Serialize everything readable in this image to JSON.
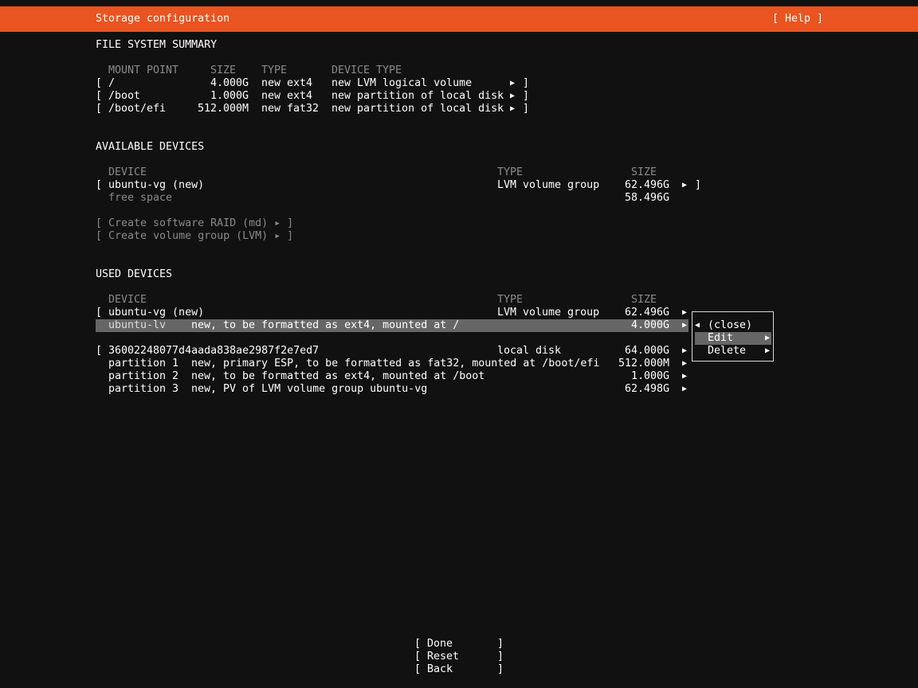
{
  "header": {
    "title": "Storage configuration",
    "help": "[ Help ]"
  },
  "fs_summary": {
    "heading": "FILE SYSTEM SUMMARY",
    "columns": {
      "mount": "MOUNT POINT",
      "size": "SIZE",
      "type": "TYPE",
      "device_type": "DEVICE TYPE"
    },
    "rows": [
      {
        "mount": "/",
        "size": "4.000G",
        "type": "new ext4",
        "device_type": "new LVM logical volume"
      },
      {
        "mount": "/boot",
        "size": "1.000G",
        "type": "new ext4",
        "device_type": "new partition of local disk"
      },
      {
        "mount": "/boot/efi",
        "size": "512.000M",
        "type": "new fat32",
        "device_type": "new partition of local disk"
      }
    ]
  },
  "available": {
    "heading": "AVAILABLE DEVICES",
    "columns": {
      "device": "DEVICE",
      "type": "TYPE",
      "size": "SIZE"
    },
    "vg_name": "ubuntu-vg (new)",
    "vg_type": "LVM volume group",
    "vg_size": "62.496G",
    "free_label": "free space",
    "free_size": "58.496G",
    "raid_action": "[ Create software RAID (md) ▸ ]",
    "lvm_action": "[ Create volume group (LVM) ▸ ]"
  },
  "used": {
    "heading": "USED DEVICES",
    "columns": {
      "device": "DEVICE",
      "type": "TYPE",
      "size": "SIZE"
    },
    "vg_name": "ubuntu-vg (new)",
    "vg_type": "LVM volume group",
    "vg_size": "62.496G",
    "lv_name": "ubuntu-lv",
    "lv_desc": "new, to be formatted as ext4, mounted at /",
    "lv_size": "4.000G",
    "disk_name": "36002248077d4aada838ae2987f2e7ed7",
    "disk_type": "local disk",
    "disk_size": "64.000G",
    "partitions": [
      {
        "name": "partition 1",
        "desc": "new, primary ESP, to be formatted as fat32, mounted at /boot/efi",
        "size": "512.000M"
      },
      {
        "name": "partition 2",
        "desc": "new, to be formatted as ext4, mounted at /boot",
        "size": "1.000G"
      },
      {
        "name": "partition 3",
        "desc": "new, PV of LVM volume group ubuntu-vg",
        "size": "62.498G"
      }
    ]
  },
  "context_menu": {
    "close": "(close)",
    "edit": "Edit",
    "delete": "Delete"
  },
  "footer": {
    "done": "Done",
    "reset": "Reset",
    "back": "Back"
  },
  "colors": {
    "accent": "#e95420",
    "background": "#111111",
    "highlight": "#666666",
    "dim_text": "#8a8a8a"
  },
  "icons": {
    "arrow_right": "arrow-right-icon",
    "arrow_left": "arrow-left-icon"
  }
}
